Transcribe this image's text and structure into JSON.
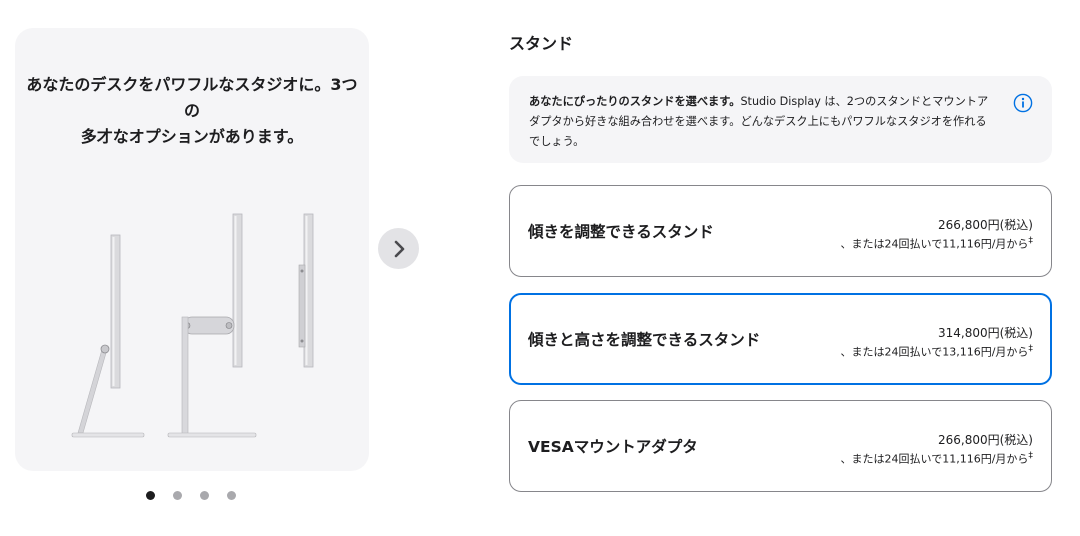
{
  "gallery": {
    "headline_line1": "あなたのデスクをパワフルなスタジオに。3つの",
    "headline_line2": "多才なオプションがあります。",
    "images": [
      "tilt-adjustable-stand",
      "tilt-and-height-adjustable-stand",
      "vesa-mount-adapter"
    ],
    "next_icon": "chevron-right-icon",
    "pagination": {
      "count": 4,
      "active_index": 0
    }
  },
  "stand_section": {
    "title": "スタンド",
    "info": {
      "lead": "あなたにぴったりのスタンドを選べます。",
      "body": "Studio Display は、2つのスタンドとマウントアダプタから好きな組み合わせを選べます。どんなデスク上にもパワフルなスタジオを作れるでしょう。",
      "icon": "info-circle-icon"
    },
    "options": [
      {
        "name": "傾きを調整できるスタンド",
        "price": "266,800円(税込)",
        "monthly": "、または24回払いで11,116円/月から",
        "footnote": "‡",
        "selected": false
      },
      {
        "name": "傾きと高さを調整できるスタンド",
        "price": "314,800円(税込)",
        "monthly": "、または24回払いで13,116円/月から",
        "footnote": "‡",
        "selected": true
      },
      {
        "name": "VESAマウントアダプタ",
        "price": "266,800円(税込)",
        "monthly": "、または24回払いで11,116円/月から",
        "footnote": "‡",
        "selected": false
      }
    ]
  },
  "colors": {
    "accent": "#0071e3",
    "panel_bg": "#f5f5f7",
    "text": "#1d1d1f",
    "border": "#86868b"
  }
}
